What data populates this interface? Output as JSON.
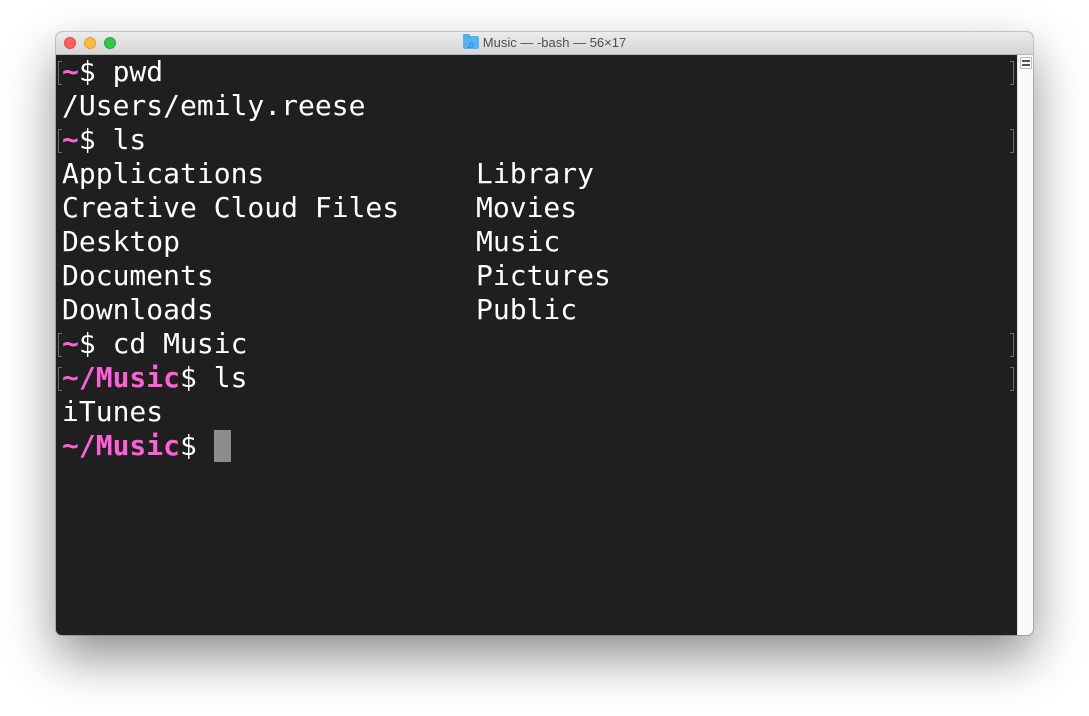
{
  "window": {
    "title": "Music — -bash — 56×17",
    "title_icon": "music-folder-icon"
  },
  "terminal": {
    "colors": {
      "background": "#1f1f1f",
      "text": "#ffffff",
      "prompt": "#ff5fd7",
      "cursor": "#8c8c8c"
    },
    "lines": [
      {
        "prompt": "~",
        "command": "$ pwd"
      },
      {
        "output": "/Users/emily.reese"
      },
      {
        "prompt": "~",
        "command": "$ ls"
      },
      {
        "col1": "Applications",
        "col2": "Library"
      },
      {
        "col1": "Creative Cloud Files",
        "col2": "Movies"
      },
      {
        "col1": "Desktop",
        "col2": "Music"
      },
      {
        "col1": "Documents",
        "col2": "Pictures"
      },
      {
        "col1": "Downloads",
        "col2": "Public"
      },
      {
        "prompt": "~",
        "command": "$ cd Music"
      },
      {
        "prompt": "~/Music",
        "command": "$ ls"
      },
      {
        "output": "iTunes"
      },
      {
        "prompt": "~/Music",
        "command": "$ "
      }
    ]
  }
}
